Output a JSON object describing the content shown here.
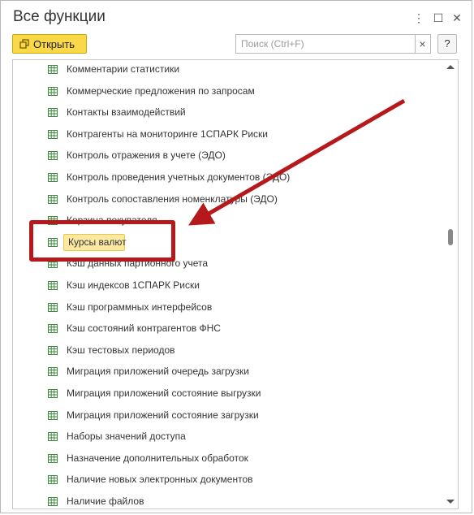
{
  "window": {
    "title": "Все функции",
    "controls": [
      "⋮",
      "☐",
      "✕"
    ]
  },
  "toolbar": {
    "open_label": "Открыть",
    "search_placeholder": "Поиск (Ctrl+F)",
    "clear_label": "×",
    "help_label": "?"
  },
  "list": {
    "items": [
      {
        "label": "Комментарии статистики"
      },
      {
        "label": "Коммерческие предложения по запросам"
      },
      {
        "label": "Контакты взаимодействий"
      },
      {
        "label": "Контрагенты на мониторинге 1СПАРК Риски"
      },
      {
        "label": "Контроль отражения в учете (ЭДО)"
      },
      {
        "label": "Контроль проведения учетных документов (ЭДО)"
      },
      {
        "label": "Контроль сопоставления номенклатуры (ЭДО)"
      },
      {
        "label": "Корзина покупателя"
      },
      {
        "label": "Курсы валют",
        "selected": true
      },
      {
        "label": "Кэш данных партионного учета"
      },
      {
        "label": "Кэш индексов 1СПАРК Риски"
      },
      {
        "label": "Кэш программных интерфейсов"
      },
      {
        "label": "Кэш состояний контрагентов ФНС"
      },
      {
        "label": "Кэш тестовых периодов"
      },
      {
        "label": "Миграция приложений очередь загрузки"
      },
      {
        "label": "Миграция приложений состояние выгрузки"
      },
      {
        "label": "Миграция приложений состояние загрузки"
      },
      {
        "label": "Наборы значений доступа"
      },
      {
        "label": "Назначение дополнительных обработок"
      },
      {
        "label": "Наличие новых электронных документов"
      },
      {
        "label": "Наличие файлов"
      }
    ]
  },
  "colors": {
    "highlight_box": "#b5191c",
    "selection_fill": "#fbe9a2",
    "open_button": "#f9d84a"
  },
  "icons": [
    "open-icon",
    "table-icon",
    "annotation-arrow"
  ]
}
